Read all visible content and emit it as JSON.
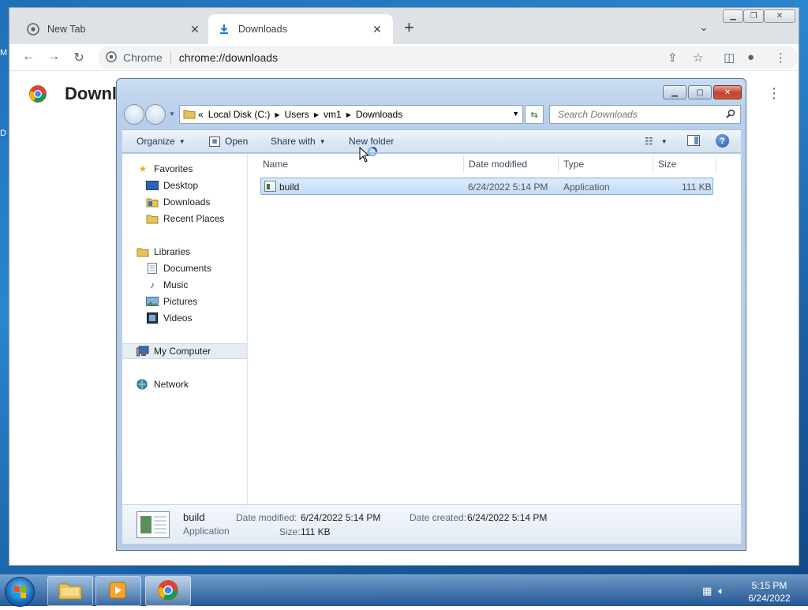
{
  "desktop": {
    "edge_char_1": "M",
    "edge_char_2": "D"
  },
  "chrome": {
    "tabs": [
      {
        "title": "New Tab",
        "icon": "chrome-icon"
      },
      {
        "title": "Downloads",
        "icon": "download-icon"
      }
    ],
    "omnibox": {
      "site": "Chrome",
      "url": "chrome://downloads"
    },
    "page_title": "Downloads"
  },
  "explorer": {
    "breadcrumbs": [
      "Local Disk (C:)",
      "Users",
      "vm1",
      "Downloads"
    ],
    "breadcrumb_prefix": "«",
    "search_placeholder": "Search Downloads",
    "commands": {
      "organize": "Organize",
      "open": "Open",
      "share_with": "Share with",
      "new_folder": "New folder"
    },
    "nav": {
      "favorites": "Favorites",
      "favorites_items": [
        "Desktop",
        "Downloads",
        "Recent Places"
      ],
      "libraries": "Libraries",
      "libraries_items": [
        "Documents",
        "Music",
        "Pictures",
        "Videos"
      ],
      "my_computer": "My Computer",
      "network": "Network"
    },
    "columns": [
      "Name",
      "Date modified",
      "Type",
      "Size"
    ],
    "files": [
      {
        "name": "build",
        "date_modified": "6/24/2022 5:14 PM",
        "type": "Application",
        "size": "111 KB"
      }
    ],
    "details": {
      "name": "build",
      "type": "Application",
      "date_modified_label": "Date modified:",
      "date_modified": "6/24/2022 5:14 PM",
      "date_created_label": "Date created:",
      "date_created": "6/24/2022 5:14 PM",
      "size_label": "Size:",
      "size": "111 KB"
    }
  },
  "taskbar": {
    "apps": [
      "windows-explorer",
      "media-player",
      "google-chrome"
    ],
    "clock_time": "5:15 PM",
    "clock_date": "6/24/2022"
  },
  "colors": {
    "desktop_blue": "#1e6fb8",
    "chrome_tabstrip": "#dee1e6",
    "selection_blue": "#c3dcf7",
    "close_red": "#c4412c"
  }
}
